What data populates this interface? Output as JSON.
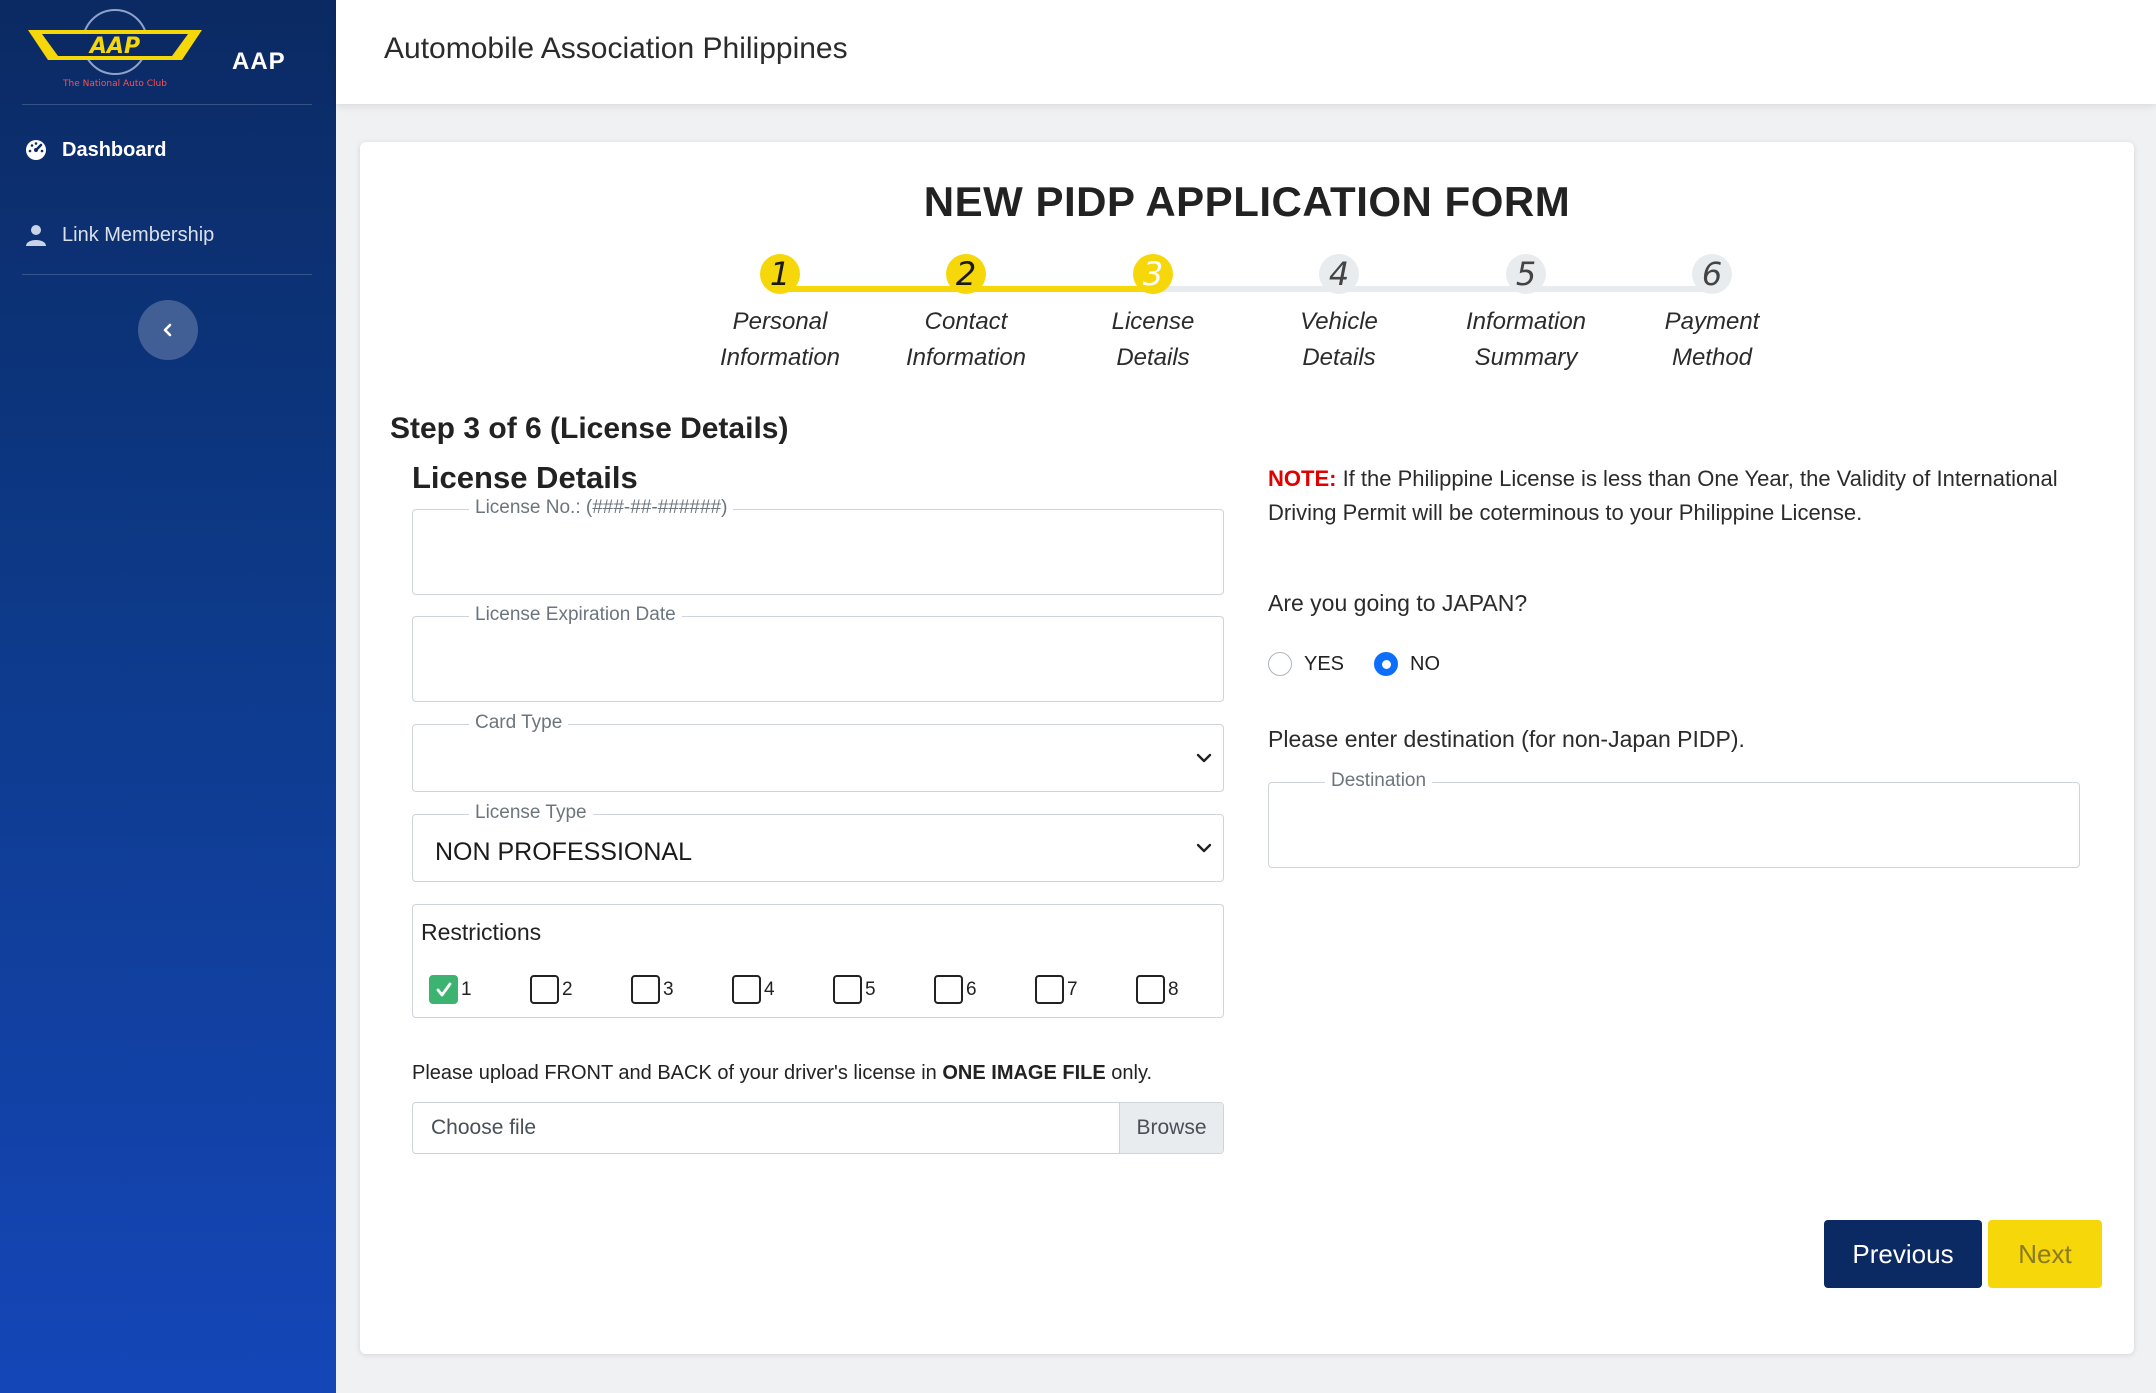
{
  "sidebar": {
    "brand": "AAP",
    "logo": {
      "tagline": "The National Auto Club"
    },
    "items": [
      {
        "label": "Dashboard",
        "icon": "gauge-icon",
        "active": true
      },
      {
        "label": "Link Membership",
        "icon": "user-icon",
        "active": false
      }
    ],
    "collapse_icon": "chevron-left-icon"
  },
  "header": {
    "title": "Automobile Association Philippines"
  },
  "form": {
    "title": "NEW PIDP APPLICATION FORM",
    "steps": [
      {
        "num": "1",
        "line1": "Personal",
        "line2": "Information",
        "state": "done"
      },
      {
        "num": "2",
        "line1": "Contact",
        "line2": "Information",
        "state": "done"
      },
      {
        "num": "3",
        "line1": "License",
        "line2": "Details",
        "state": "current"
      },
      {
        "num": "4",
        "line1": "Vehicle",
        "line2": "Details",
        "state": "todo"
      },
      {
        "num": "5",
        "line1": "Information",
        "line2": "Summary",
        "state": "todo"
      },
      {
        "num": "6",
        "line1": "Payment",
        "line2": "Method",
        "state": "todo"
      }
    ],
    "step_heading": "Step 3 of 6 (License Details)",
    "section_heading": "License Details",
    "license_no": {
      "label": "License No.: (###-##-######)",
      "value": ""
    },
    "expiration": {
      "label": "License Expiration Date",
      "value": ""
    },
    "card_type": {
      "label": "Card Type",
      "value": ""
    },
    "license_type": {
      "label": "License Type",
      "value": "NON PROFESSIONAL"
    },
    "restrictions": {
      "title": "Restrictions",
      "options": [
        {
          "num": "1",
          "checked": true
        },
        {
          "num": "2",
          "checked": false
        },
        {
          "num": "3",
          "checked": false
        },
        {
          "num": "4",
          "checked": false
        },
        {
          "num": "5",
          "checked": false
        },
        {
          "num": "6",
          "checked": false
        },
        {
          "num": "7",
          "checked": false
        },
        {
          "num": "8",
          "checked": false
        }
      ]
    },
    "upload": {
      "text_pre": "Please upload FRONT and BACK of your driver's license in ",
      "text_bold": "ONE IMAGE FILE",
      "text_post": " only.",
      "placeholder": "Choose file",
      "browse": "Browse"
    },
    "note": {
      "tag": "NOTE:",
      "text": " If the Philippine License is less than One Year, the Validity of International Driving Permit will be coterminous to your Philippine License."
    },
    "japan_question": "Are you going to JAPAN?",
    "japan_options": [
      {
        "label": "YES",
        "selected": false
      },
      {
        "label": "NO",
        "selected": true
      }
    ],
    "destination_prompt": "Please enter destination (for non-Japan PIDP).",
    "destination": {
      "label": "Destination",
      "value": ""
    },
    "buttons": {
      "previous": "Previous",
      "next": "Next"
    }
  },
  "colors": {
    "navy": "#0b2a63",
    "accent_yellow": "#f6d70a",
    "note_red": "#e00000",
    "check_green": "#3cb371",
    "radio_blue": "#0d6efd"
  }
}
